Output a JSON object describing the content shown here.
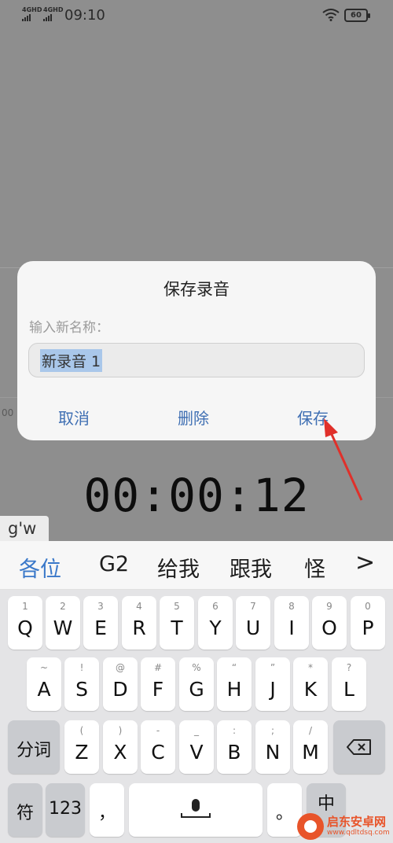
{
  "status_bar": {
    "signal1": "4GHD",
    "signal2": "4GHD",
    "time": "09:10",
    "battery": "60"
  },
  "background": {
    "tick_label": "00"
  },
  "dialog": {
    "title": "保存录音",
    "prompt": "输入新名称：",
    "input_value": "新录音 1",
    "cancel": "取消",
    "delete": "删除",
    "save": "保存"
  },
  "timer": "00:00:12",
  "keyboard": {
    "composing": "g'w",
    "candidates": [
      "各位",
      "G2",
      "给我",
      "跟我",
      "怪"
    ],
    "more": ">",
    "row1": [
      {
        "hint": "1",
        "key": "Q"
      },
      {
        "hint": "2",
        "key": "W"
      },
      {
        "hint": "3",
        "key": "E"
      },
      {
        "hint": "4",
        "key": "R"
      },
      {
        "hint": "5",
        "key": "T"
      },
      {
        "hint": "6",
        "key": "Y"
      },
      {
        "hint": "7",
        "key": "U"
      },
      {
        "hint": "8",
        "key": "I"
      },
      {
        "hint": "9",
        "key": "O"
      },
      {
        "hint": "0",
        "key": "P"
      }
    ],
    "row2": [
      {
        "hint": "~",
        "key": "A"
      },
      {
        "hint": "!",
        "key": "S"
      },
      {
        "hint": "@",
        "key": "D"
      },
      {
        "hint": "#",
        "key": "F"
      },
      {
        "hint": "%",
        "key": "G"
      },
      {
        "hint": "“",
        "key": "H"
      },
      {
        "hint": "”",
        "key": "J"
      },
      {
        "hint": "*",
        "key": "K"
      },
      {
        "hint": "?",
        "key": "L"
      }
    ],
    "row3": [
      {
        "hint": "(",
        "key": "Z"
      },
      {
        "hint": ")",
        "key": "X"
      },
      {
        "hint": "-",
        "key": "C"
      },
      {
        "hint": "_",
        "key": "V"
      },
      {
        "hint": ":",
        "key": "B"
      },
      {
        "hint": ";",
        "key": "N"
      },
      {
        "hint": "/",
        "key": "M"
      }
    ],
    "segment_key": "分词",
    "symbol_key": "符",
    "number_key": "123",
    "comma_key": "，",
    "period_key": "。",
    "lang_key": "中"
  },
  "watermark": {
    "name": "启东安卓网",
    "url": "www.qdltdsq.com"
  },
  "colors": {
    "accent": "#3f6fb3",
    "candidate_active": "#3a78c9",
    "arrow": "#e0302a",
    "overlay": "#8e8e8e"
  }
}
